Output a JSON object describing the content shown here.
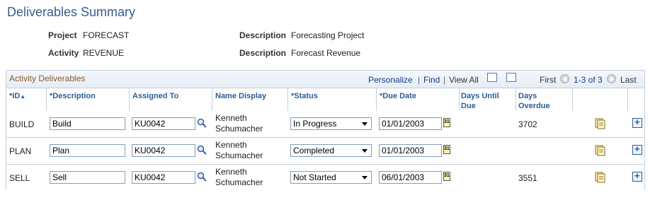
{
  "page": {
    "title": "Deliverables Summary"
  },
  "header": {
    "project_label": "Project",
    "project_value": "FORECAST",
    "activity_label": "Activity",
    "activity_value": "REVENUE",
    "desc1_label": "Description",
    "desc1_value": "Forecasting Project",
    "desc2_label": "Description",
    "desc2_value": "Forecast Revenue"
  },
  "grid": {
    "title": "Activity Deliverables",
    "personalize": "Personalize",
    "find": "Find",
    "view_all": "View All",
    "sep": "|",
    "first": "First",
    "range": "1-3 of 3",
    "last": "Last",
    "columns": {
      "id": "*ID",
      "description": "*Description",
      "assigned_to": "Assigned To",
      "name_display": "Name Display",
      "status": "*Status",
      "due_date": "*Due Date",
      "days_until_due": "Days Until Due",
      "days_overdue": "Days Overdue"
    },
    "rows": [
      {
        "id": "BUILD",
        "description": "Build",
        "assigned_to": "KU0042",
        "name_line1": "Kenneth",
        "name_line2": "Schumacher",
        "status": "In Progress",
        "due_date": "01/01/2003",
        "days_until_due": "",
        "days_overdue": "3702"
      },
      {
        "id": "PLAN",
        "description": "Plan",
        "assigned_to": "KU0042",
        "name_line1": "Kenneth",
        "name_line2": "Schumacher",
        "status": "Completed",
        "due_date": "01/01/2003",
        "days_until_due": "",
        "days_overdue": ""
      },
      {
        "id": "SELL",
        "description": "Sell",
        "assigned_to": "KU0042",
        "name_line1": "Kenneth",
        "name_line2": "Schumacher",
        "status": "Not Started",
        "due_date": "06/01/2003",
        "days_until_due": "",
        "days_overdue": "3551"
      }
    ]
  },
  "colors": {
    "title": "#365d8f",
    "link": "#0b3c8e",
    "grid_border": "#c3cfdc",
    "grid_title": "#8b5a2b"
  }
}
